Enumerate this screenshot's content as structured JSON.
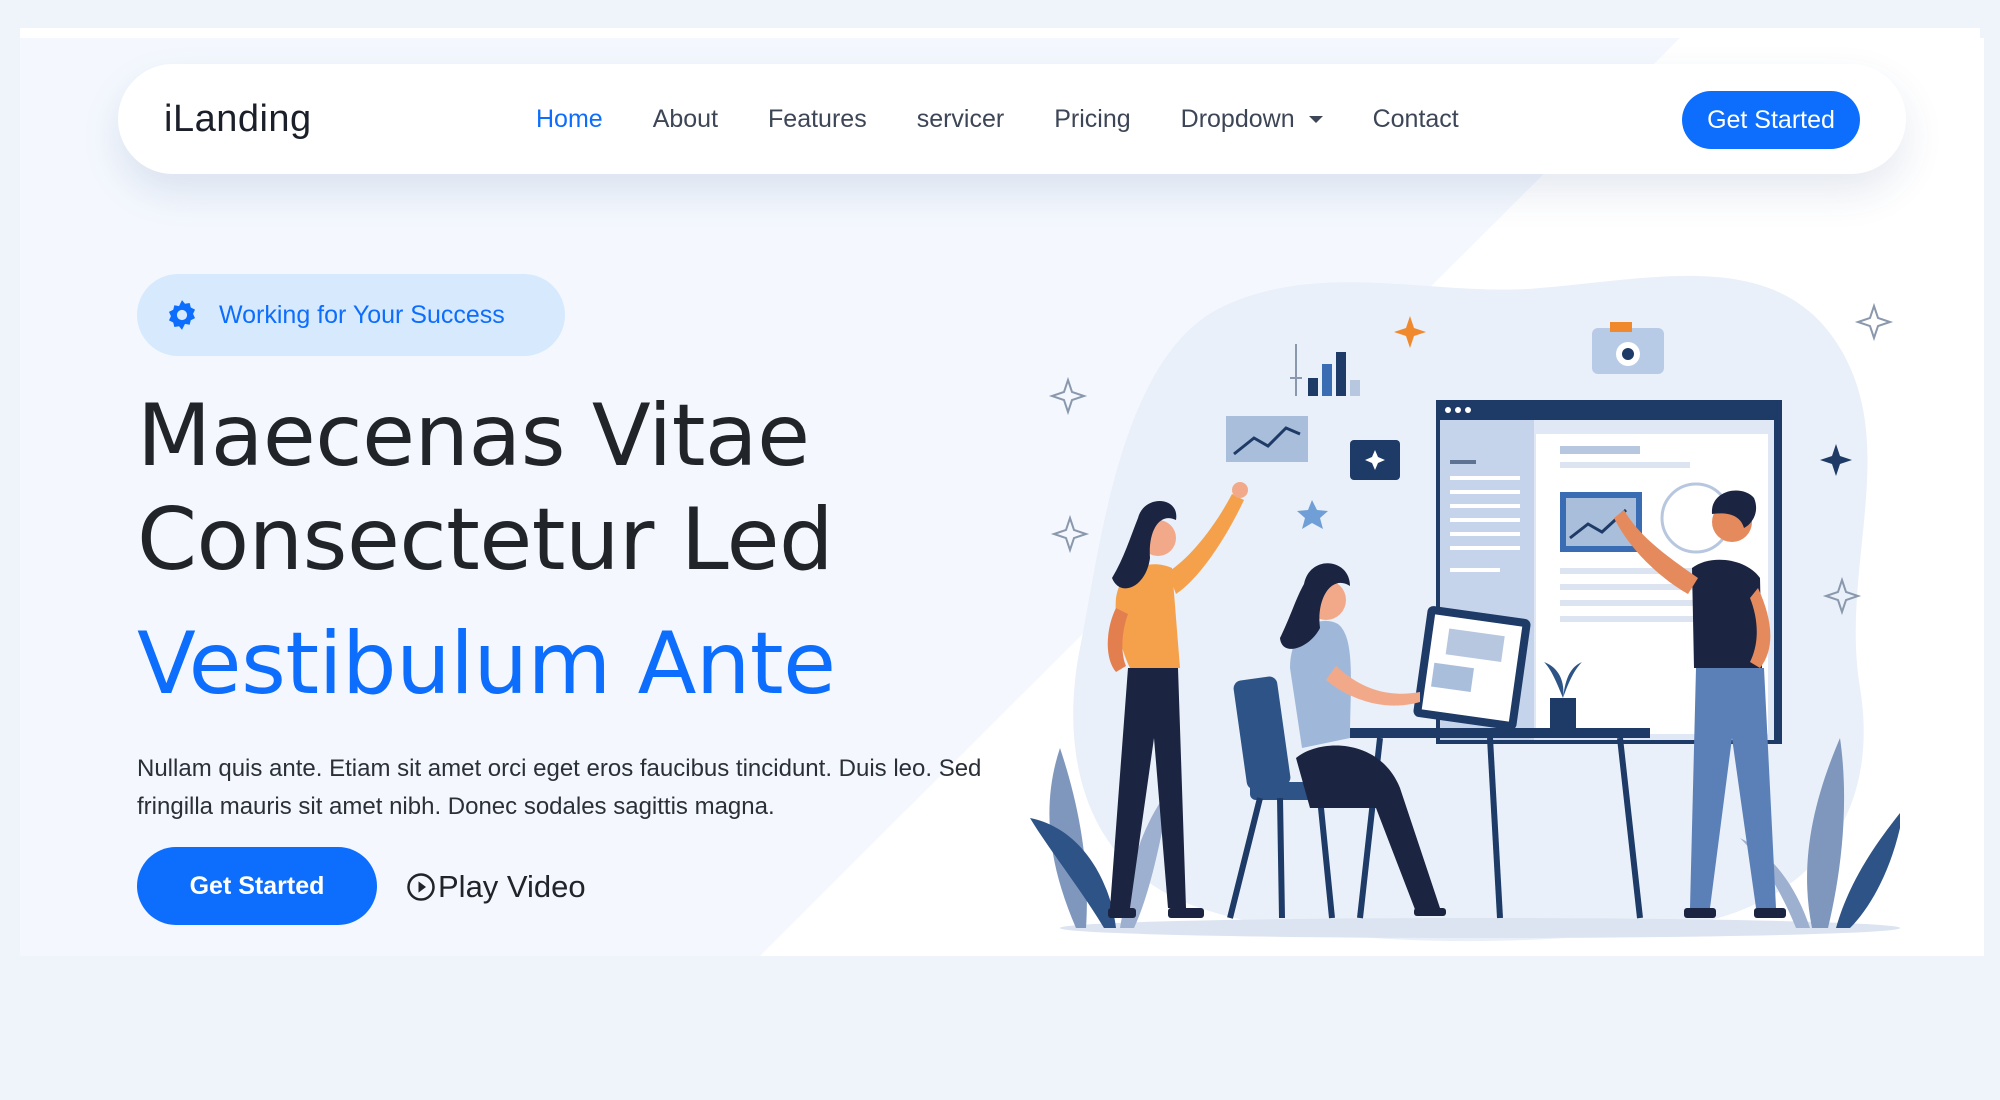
{
  "header": {
    "logo": "iLanding",
    "nav": [
      {
        "label": "Home",
        "active": true
      },
      {
        "label": "About"
      },
      {
        "label": "Features"
      },
      {
        "label": "servicer"
      },
      {
        "label": "Pricing"
      },
      {
        "label": "Dropdown",
        "has_caret": true
      },
      {
        "label": "Contact"
      }
    ],
    "cta_label": "Get Started"
  },
  "hero": {
    "badge_text": "Working for Your Success",
    "badge_icon": "gear-icon",
    "title_line1": "Maecenas Vitae",
    "title_line2": "Consectetur Led",
    "title_highlight": "Vestibulum Ante",
    "description": "Nullam quis ante. Etiam sit amet orci eget eros faucibus tincidunt. Duis leo. Sed fringilla mauris sit amet nibh. Donec sodales sagittis magna.",
    "cta_label": "Get Started",
    "play_label": "Play Video",
    "play_icon": "play-circle-icon"
  },
  "colors": {
    "accent": "#0d6efd",
    "badge_bg": "#d7e9fd",
    "page_bg": "#eff3fa",
    "text_dark": "#212529"
  }
}
